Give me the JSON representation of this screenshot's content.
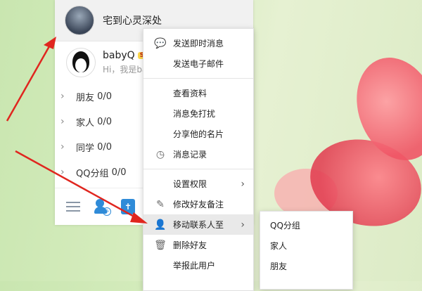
{
  "user": {
    "name": "宅到心灵深处"
  },
  "contact": {
    "name": "babyQ",
    "badge": "SVIP",
    "signature": "Hi，我是babyQ，快来和我聊天吧"
  },
  "groups": [
    {
      "label": "朋友",
      "count": "0/0"
    },
    {
      "label": "家人",
      "count": "0/0"
    },
    {
      "label": "同学",
      "count": "0/0"
    },
    {
      "label": "QQ分组",
      "count": "0/0"
    }
  ],
  "context_menu": {
    "send_instant_message": "发送即时消息",
    "send_email": "发送电子邮件",
    "view_profile": "查看资料",
    "do_not_disturb": "消息免打扰",
    "share_card": "分享他的名片",
    "message_history": "消息记录",
    "set_permissions": "设置权限",
    "edit_remark": "修改好友备注",
    "move_contact": "移动联系人至",
    "delete_friend": "删除好友",
    "report_user": "举报此用户"
  },
  "submenu": {
    "items": [
      "QQ分组",
      "家人",
      "朋友"
    ]
  },
  "colors": {
    "annotation_arrow": "#e0261f",
    "accent": "#2f8bd8",
    "menu_highlight": "#e9e9e9"
  }
}
